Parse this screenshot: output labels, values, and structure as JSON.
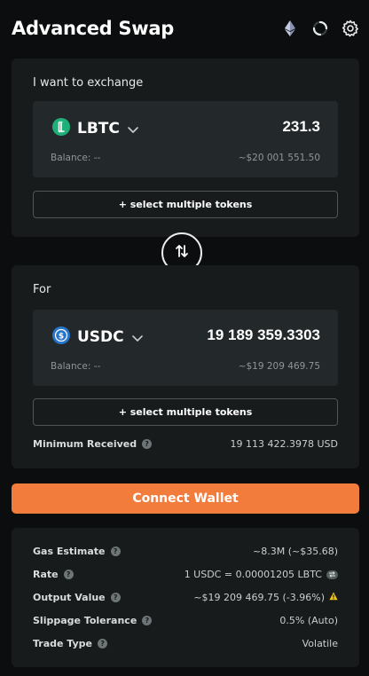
{
  "header": {
    "title": "Advanced Swap",
    "icons": [
      "ethereum-icon",
      "refresh-icon",
      "gear-icon"
    ]
  },
  "from": {
    "label": "I want to exchange",
    "token": "LBTC",
    "token_icon": "lbtc-icon",
    "amount": "231.3",
    "balance": "Balance: --",
    "usd_value": "~$20 001 551.50",
    "multi_label": "+ select multiple tokens"
  },
  "to": {
    "label": "For",
    "token": "USDC",
    "token_icon": "usdc-icon",
    "amount": "19 189 359.3303",
    "balance": "Balance: --",
    "usd_value": "~$19 209 469.75",
    "multi_label": "+ select multiple tokens",
    "min_received_label": "Minimum Received",
    "min_received_value": "19 113 422.3978 USD"
  },
  "connect_label": "Connect Wallet",
  "details": {
    "gas_label": "Gas Estimate",
    "gas_value": "~8.3M (~$35.68)",
    "rate_label": "Rate",
    "rate_value": "1 USDC = 0.00001205 LBTC",
    "output_label": "Output Value",
    "output_value": "~$19 209 469.75 (-3.96%)",
    "slippage_label": "Slippage Tolerance",
    "slippage_value": "0.5% (Auto)",
    "trade_label": "Trade Type",
    "trade_value": "Volatile"
  },
  "colors": {
    "accent": "#f27c3c",
    "lbtc": "#1fb07a",
    "usdc": "#2775ca",
    "warning": "#f5c518"
  }
}
